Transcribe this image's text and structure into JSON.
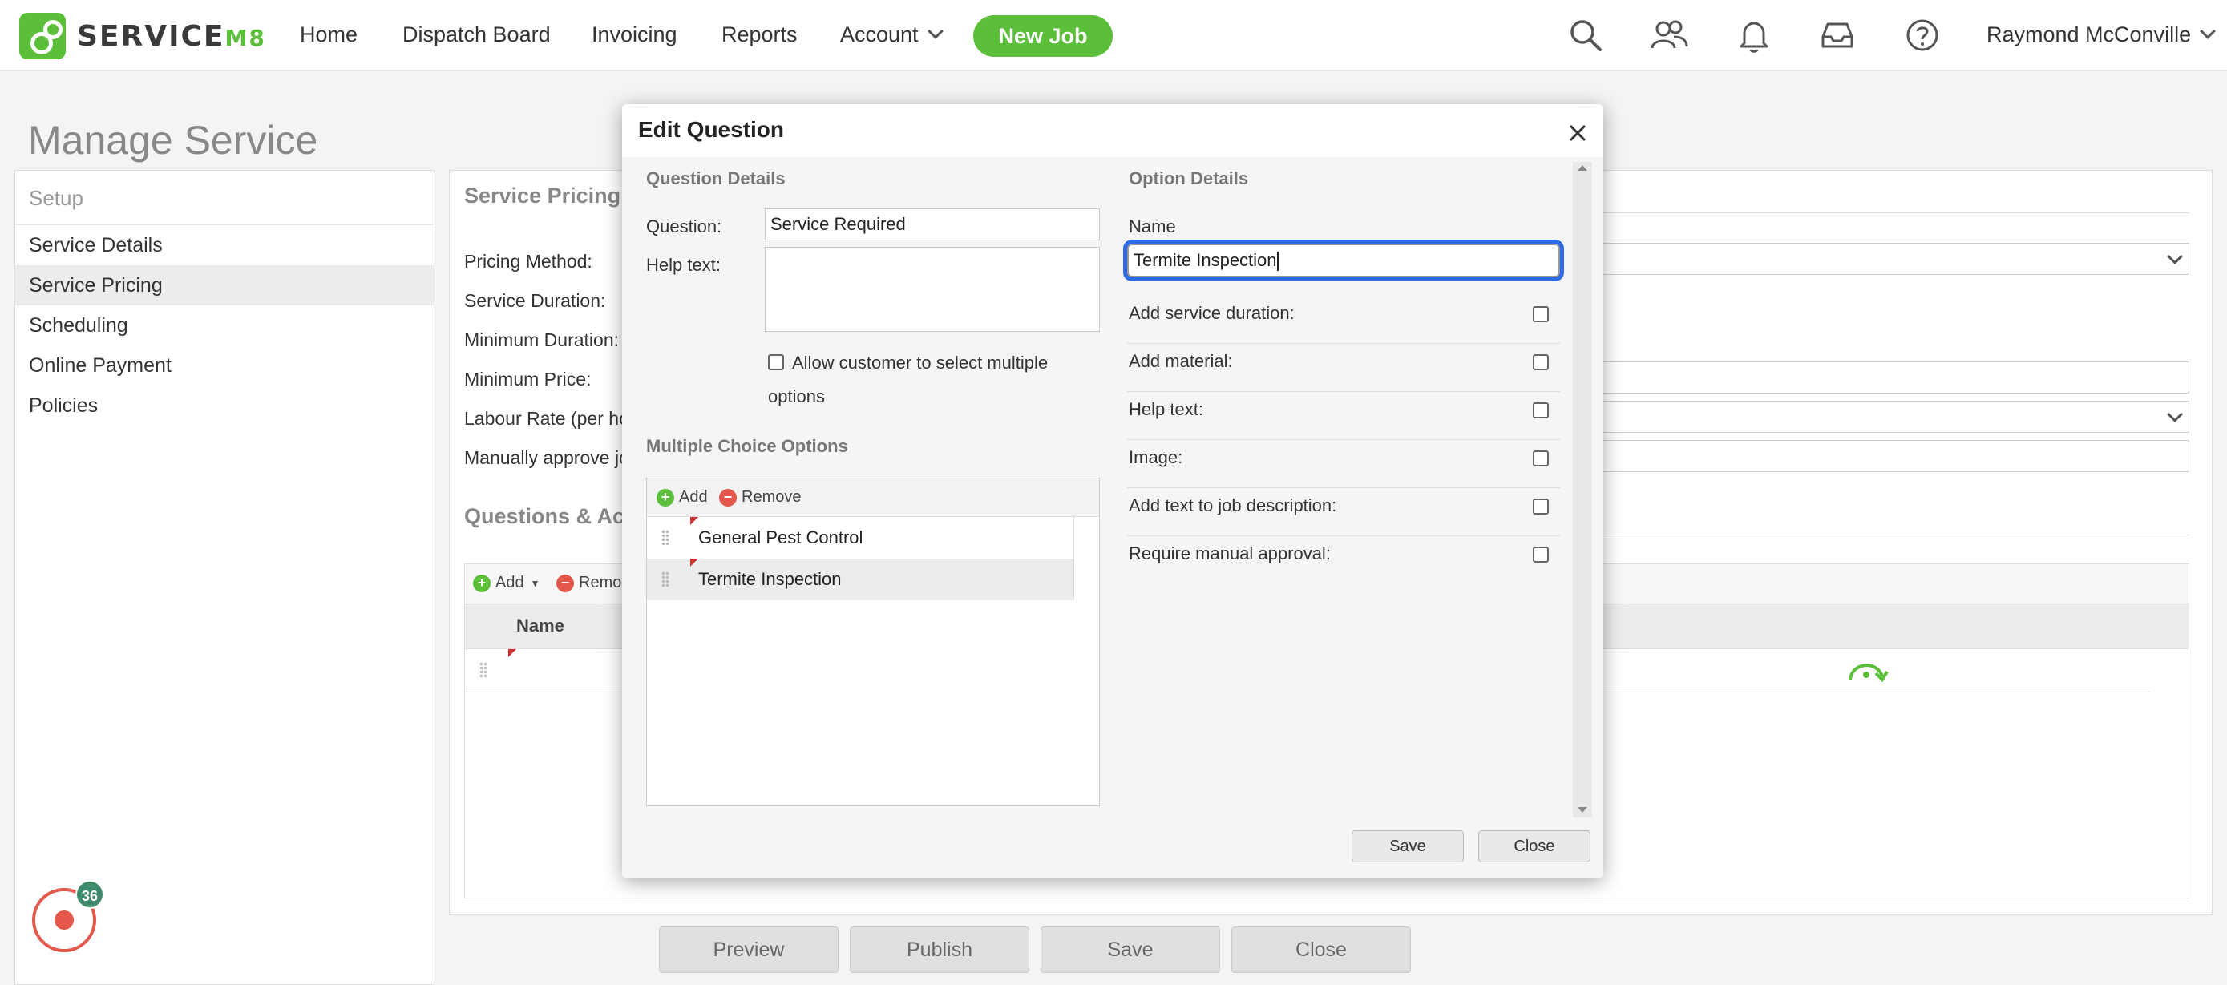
{
  "app": {
    "brand_text": "SERVICE",
    "brand_suffix": "M8"
  },
  "nav": {
    "home": "Home",
    "dispatch": "Dispatch Board",
    "invoicing": "Invoicing",
    "reports": "Reports",
    "account": "Account",
    "new_job": "New Job",
    "user": "Raymond McConville",
    "icons": [
      "search-icon",
      "people-icon",
      "bell-icon",
      "inbox-icon",
      "help-icon"
    ]
  },
  "page": {
    "title": "Manage Service"
  },
  "sidebar": {
    "heading": "Setup",
    "items": [
      "Service Details",
      "Service Pricing",
      "Scheduling",
      "Online Payment",
      "Policies"
    ],
    "active": "Service Pricing"
  },
  "notifications": {
    "count": "36"
  },
  "main": {
    "section_title": "Service Pricing",
    "labels": [
      "Pricing Method:",
      "Service Duration:",
      "Minimum Duration:",
      "Minimum Price:",
      "Labour Rate (per hou",
      "Manually approve jo"
    ],
    "qa_title": "Questions & Acti",
    "qa_add": "Add",
    "qa_remove": "Remo",
    "qa_col_name": "Name"
  },
  "bottom": {
    "preview": "Preview",
    "publish": "Publish",
    "save": "Save",
    "close": "Close"
  },
  "modal": {
    "title": "Edit Question",
    "question_details": "Question Details",
    "question_label": "Question:",
    "question_value": "Service Required",
    "help_label": "Help text:",
    "help_value": "",
    "allow_multi_line1": "Allow customer to select multiple",
    "allow_multi_line2": "options",
    "multiple_choice": "Multiple Choice Options",
    "add": "Add",
    "remove": "Remove",
    "options": [
      "General Pest Control",
      "Termite Inspection"
    ],
    "selected_option": "Termite Inspection",
    "option_details": "Option Details",
    "name_label": "Name",
    "name_value": "Termite Inspection",
    "option_fields": [
      "Add service duration:",
      "Add material:",
      "Help text:",
      "Image:",
      "Add text to job description:",
      "Require manual approval:"
    ],
    "save": "Save",
    "close": "Close"
  },
  "colors": {
    "brand_green": "#5bbf3a",
    "focus_blue": "#2f6be8",
    "danger_red": "#e4574b"
  }
}
